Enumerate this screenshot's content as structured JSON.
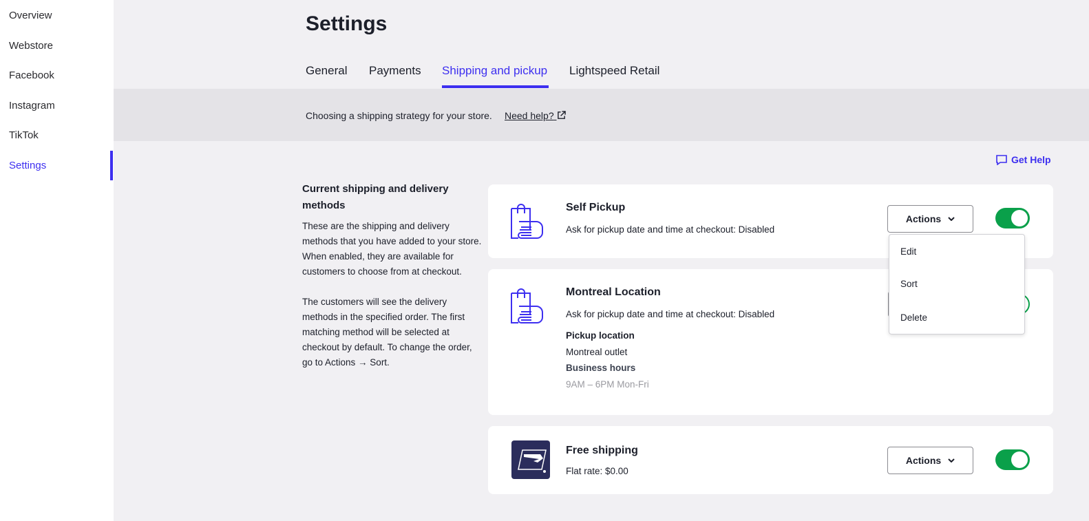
{
  "sidebar": {
    "items": [
      {
        "label": "Overview"
      },
      {
        "label": "Webstore"
      },
      {
        "label": "Facebook"
      },
      {
        "label": "Instagram"
      },
      {
        "label": "TikTok"
      },
      {
        "label": "Settings",
        "active": true
      }
    ]
  },
  "header": {
    "title": "Settings",
    "tabs": [
      {
        "label": "General"
      },
      {
        "label": "Payments"
      },
      {
        "label": "Shipping and pickup",
        "active": true
      },
      {
        "label": "Lightspeed Retail"
      }
    ]
  },
  "banner": {
    "text": "Choosing a shipping strategy for your store.",
    "link": "Need help?"
  },
  "get_help": "Get Help",
  "intro": {
    "title": "Current shipping and delivery methods",
    "p1": "These are the shipping and delivery methods that you have added to your store. When enabled, they are available for customers to choose from at checkout.",
    "p2": "The customers will see the delivery methods in the specified order. The first matching method will be selected at checkout by default. To change the order, go to Actions → Sort."
  },
  "methods": [
    {
      "title": "Self Pickup",
      "subtitle": "Ask for pickup date and time at checkout: Disabled",
      "icon": "pickup-bag-icon",
      "enabled": true,
      "actions": "Actions"
    },
    {
      "title": "Montreal Location",
      "subtitle": "Ask for pickup date and time at checkout: Disabled",
      "icon": "pickup-bag-icon",
      "enabled": true,
      "pickup_label": "Pickup location",
      "pickup_value": "Montreal outlet",
      "hours_label": "Business hours",
      "hours_value": "9AM – 6PM Mon-Fri"
    },
    {
      "title": "Free shipping",
      "subtitle": "Flat rate: $0.00",
      "icon": "usps-logo",
      "enabled": true,
      "actions": "Actions"
    }
  ],
  "dropdown": {
    "items": [
      "Edit",
      "Sort",
      "Delete"
    ]
  },
  "colors": {
    "accent": "#3d2ff0",
    "toggle_on": "#0aa04a",
    "background": "#f1f0f3",
    "banner": "#e4e3e7"
  }
}
